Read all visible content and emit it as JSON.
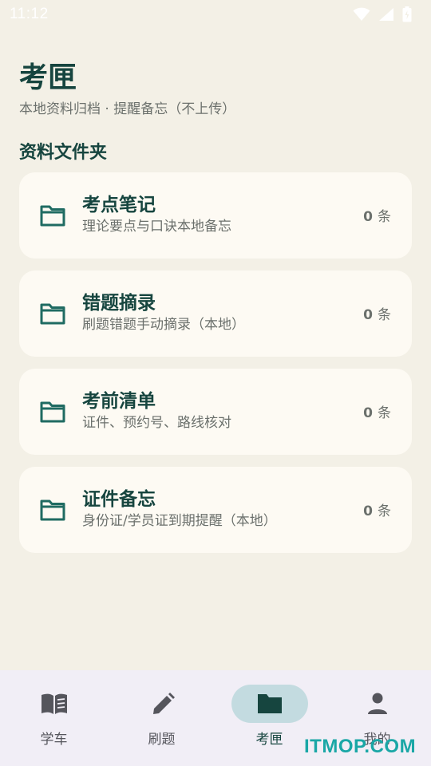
{
  "status_bar": {
    "time": "11:12"
  },
  "header": {
    "title": "考匣",
    "subtitle": "本地资料归档 · 提醒备忘（不上传）"
  },
  "section": {
    "title": "资料文件夹"
  },
  "folders": [
    {
      "name": "考点笔记",
      "desc": "理论要点与口诀本地备忘",
      "count": "0",
      "unit": "条"
    },
    {
      "name": "错题摘录",
      "desc": "刷题错题手动摘录（本地）",
      "count": "0",
      "unit": "条"
    },
    {
      "name": "考前清单",
      "desc": "证件、预约号、路线核对",
      "count": "0",
      "unit": "条"
    },
    {
      "name": "证件备忘",
      "desc": "身份证/学员证到期提醒（本地）",
      "count": "0",
      "unit": "条"
    }
  ],
  "bottom_nav": {
    "items": [
      {
        "label": "学车",
        "icon": "book-icon",
        "active": false
      },
      {
        "label": "刷题",
        "icon": "pencil-icon",
        "active": false
      },
      {
        "label": "考匣",
        "icon": "folder-icon",
        "active": true
      },
      {
        "label": "我的",
        "icon": "person-icon",
        "active": false
      }
    ]
  },
  "watermark": "ITMOP.COM",
  "colors": {
    "background": "#f3f0e6",
    "card": "#fdfaf3",
    "primary": "#16453f",
    "folder_icon": "#1f6b62",
    "nav_active_pill": "#c3dbe0",
    "nav_background": "#f1eef6"
  }
}
